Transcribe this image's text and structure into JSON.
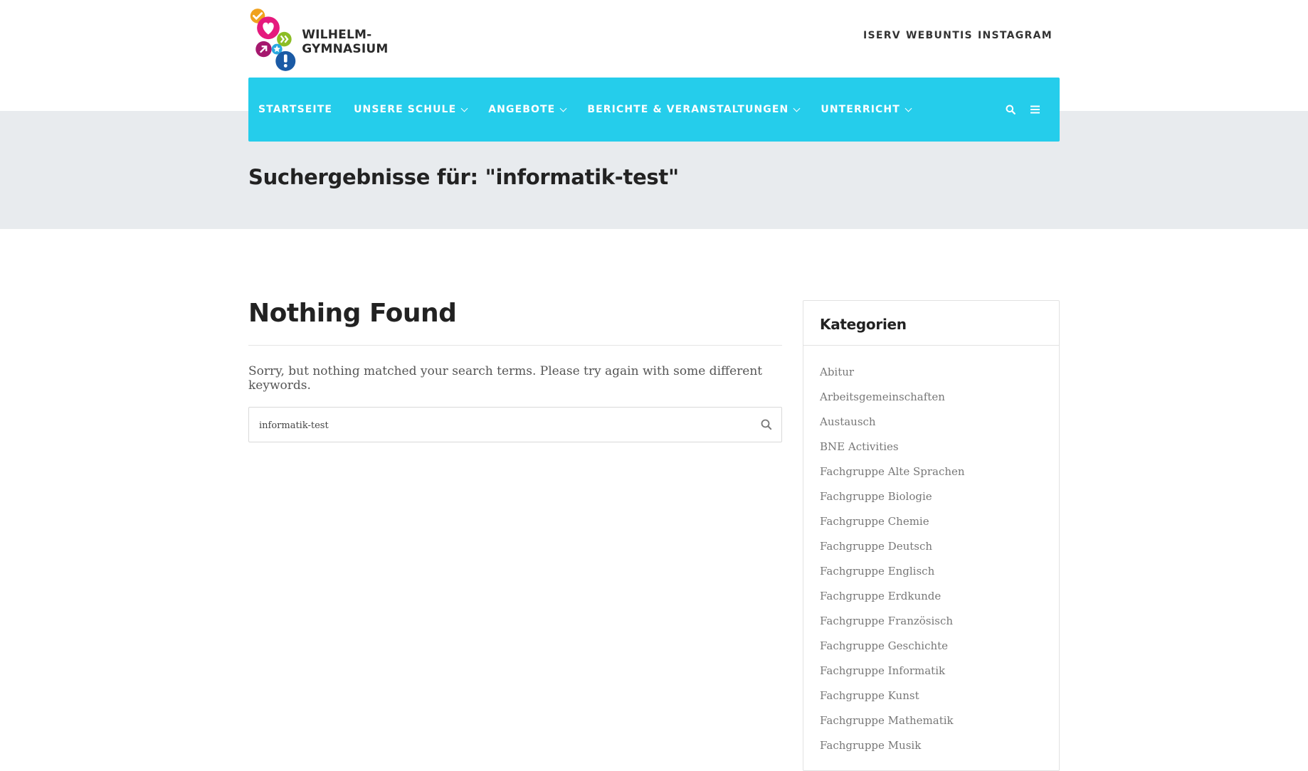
{
  "header": {
    "site_name": "WILHELM-GYMNASIUM",
    "top_links": [
      "ISERV",
      "WEBUNTIS",
      "INSTAGRAM"
    ]
  },
  "nav": {
    "items": [
      {
        "label": "STARTSEITE",
        "dropdown": false
      },
      {
        "label": "UNSERE SCHULE",
        "dropdown": true
      },
      {
        "label": "ANGEBOTE",
        "dropdown": true
      },
      {
        "label": "BERICHTE & VERANSTALTUNGEN",
        "dropdown": true
      },
      {
        "label": "UNTERRICHT",
        "dropdown": true
      }
    ],
    "icons": [
      "search-icon",
      "menu-icon"
    ]
  },
  "page": {
    "title": "Suchergebnisse für: \"informatik-test\""
  },
  "main": {
    "heading": "Nothing Found",
    "message": "Sorry, but nothing matched your search terms. Please try again with some different keywords.",
    "search_value": "informatik-test"
  },
  "sidebar": {
    "title": "Kategorien",
    "categories": [
      "Abitur",
      "Arbeitsgemeinschaften",
      "Austausch",
      "BNE Activities",
      "Fachgruppe Alte Sprachen",
      "Fachgruppe Biologie",
      "Fachgruppe Chemie",
      "Fachgruppe Deutsch",
      "Fachgruppe Englisch",
      "Fachgruppe Erdkunde",
      "Fachgruppe Französisch",
      "Fachgruppe Geschichte",
      "Fachgruppe Informatik",
      "Fachgruppe Kunst",
      "Fachgruppe Mathematik",
      "Fachgruppe Musik"
    ]
  },
  "colors": {
    "nav_bg": "#25cdeb",
    "band_bg": "#e8ebee",
    "logo_orange": "#f0a21e",
    "logo_pink": "#e5197d",
    "logo_green": "#8cbd25",
    "logo_purple": "#a5186e",
    "logo_blue": "#1a5aa5",
    "logo_lightblue": "#29a8e0"
  }
}
